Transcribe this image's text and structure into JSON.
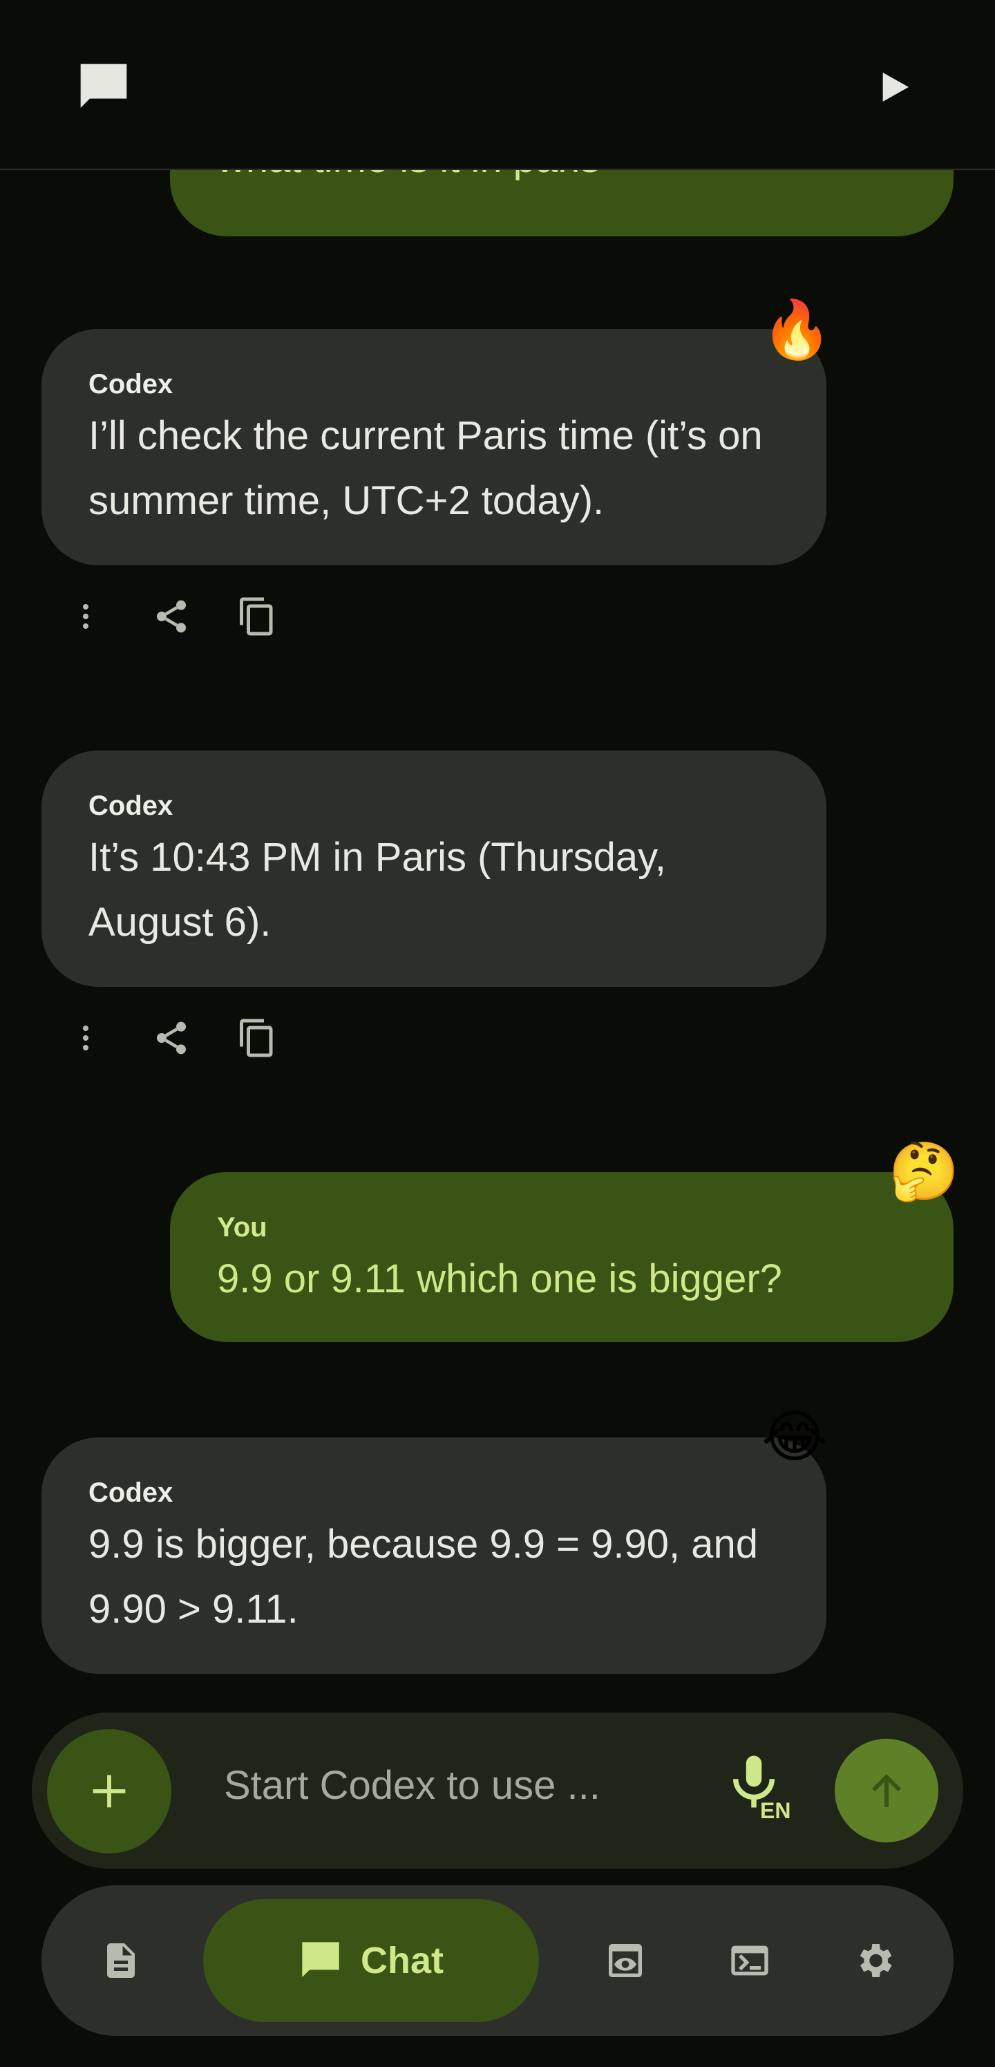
{
  "header": {
    "chat_icon": "chat-bubble-icon",
    "play_icon": "play-icon"
  },
  "messages": [
    {
      "role": "user",
      "text": "what time is it in paris"
    },
    {
      "role": "agent",
      "sender": "Codex",
      "text": "I’ll check the current Paris time (it’s on summer time, UTC+2 today).",
      "reaction": "🔥"
    },
    {
      "role": "agent",
      "sender": "Codex",
      "text": "It’s 10:43 PM in Paris (Thursday, August 6)."
    },
    {
      "role": "user",
      "sender": "You",
      "text": "9.9 or 9.11 which one is bigger?",
      "reaction": "🤔"
    },
    {
      "role": "agent",
      "sender": "Codex",
      "text": "9.9 is bigger, because 9.9 = 9.90, and 9.90 > 9.11.",
      "reaction": "😂"
    }
  ],
  "message_actions": [
    "more-vert-icon",
    "share-icon",
    "copy-icon"
  ],
  "composer": {
    "placeholder": "Start Codex to use ...",
    "mic_lang": "EN"
  },
  "nav": {
    "chat_label": "Chat",
    "items": [
      "document-icon",
      "chat-icon",
      "preview-icon",
      "terminal-icon",
      "settings-icon"
    ]
  },
  "colors": {
    "background": "#0a0c08",
    "user_bubble": "#3a5416",
    "agent_bubble": "#2c2f2a",
    "accent": "#cfe88a",
    "send_button": "#5f8026"
  }
}
